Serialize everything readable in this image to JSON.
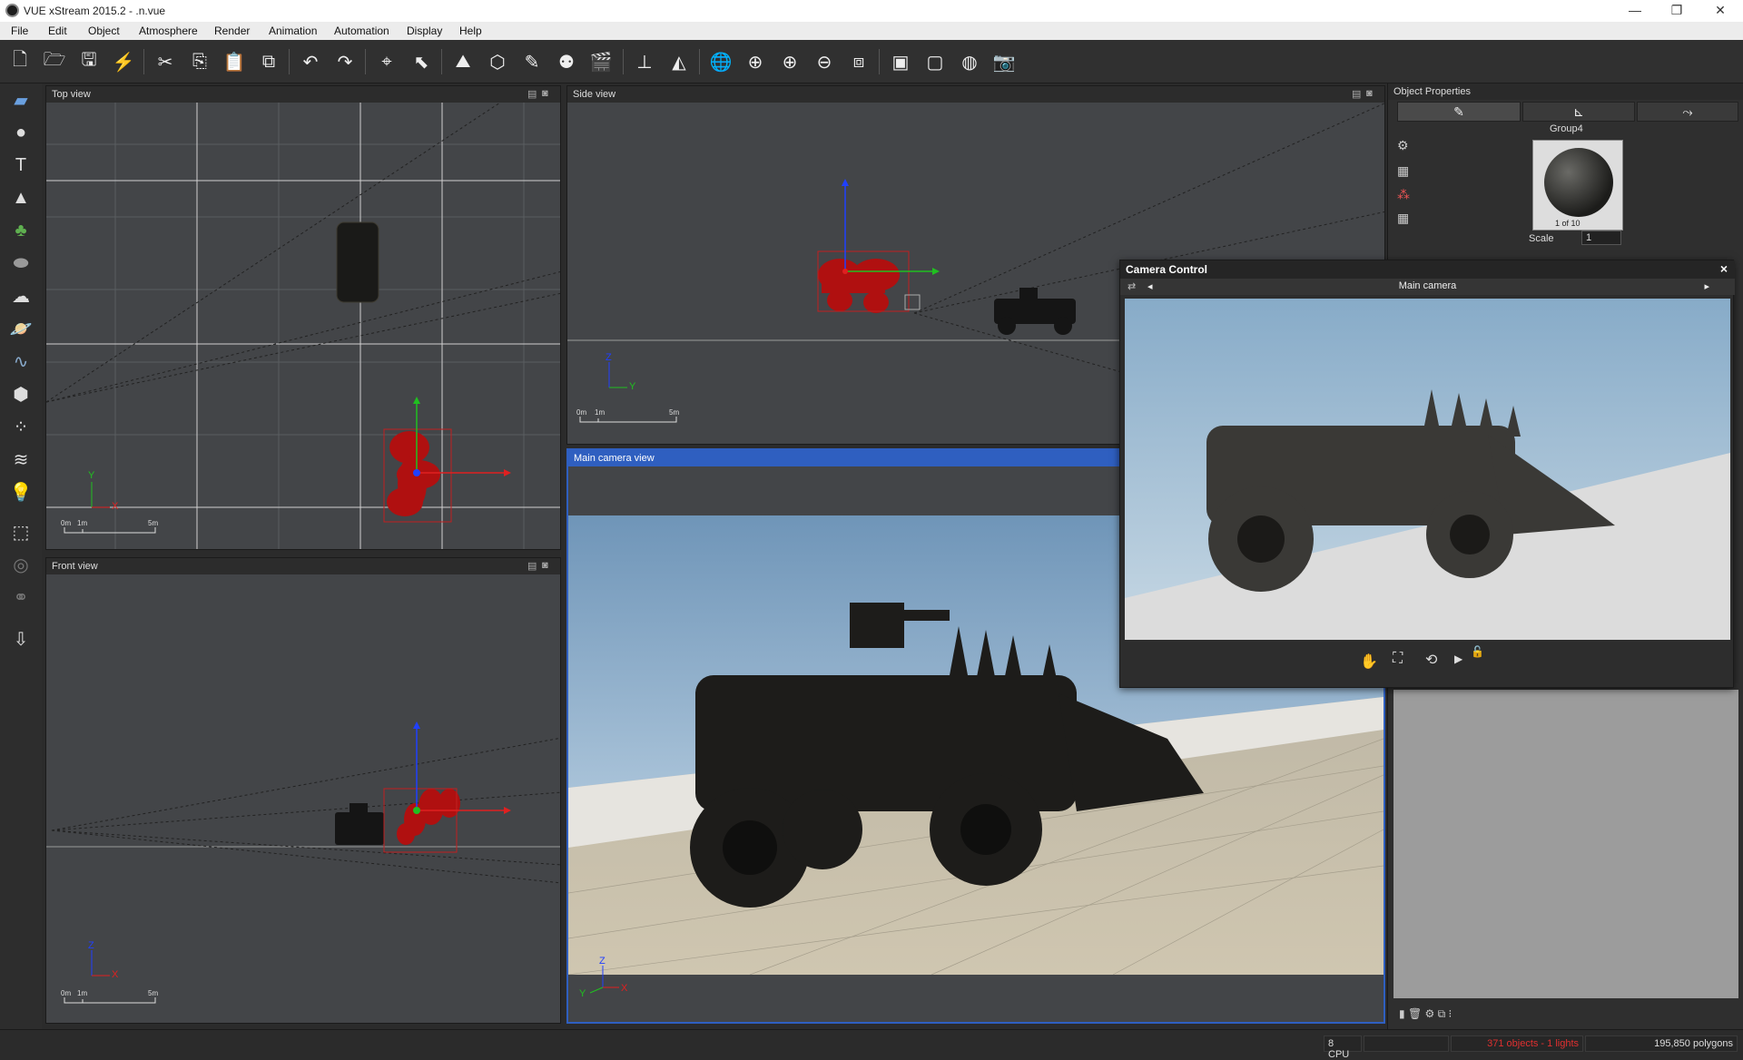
{
  "window": {
    "title": "VUE xStream 2015.2 - .n.vue",
    "minimize": "—",
    "maximize": "❐",
    "close": "✕"
  },
  "menu": [
    "File",
    "Edit",
    "Object",
    "Atmosphere",
    "Render",
    "Animation",
    "Automation",
    "Display",
    "Help"
  ],
  "viewports": {
    "top": {
      "title": "Top view",
      "scale_0": "0m",
      "scale_1": "1m",
      "scale_5": "5m",
      "axis_y": "Y",
      "axis_x": "X"
    },
    "side": {
      "title": "Side view",
      "scale_0": "0m",
      "scale_1": "1m",
      "scale_5": "5m",
      "axis_z": "Z",
      "axis_y": "Y"
    },
    "front": {
      "title": "Front view",
      "scale_0": "0m",
      "scale_1": "1m",
      "scale_5": "5m",
      "axis_z": "Z",
      "axis_x": "X"
    },
    "main": {
      "title": "Main camera view",
      "axis_z": "Z",
      "axis_y": "Y",
      "axis_x": "X"
    }
  },
  "properties": {
    "title": "Object Properties",
    "object_name": "Group4",
    "material_counter": "1 of 10",
    "scale_label": "Scale",
    "scale_value": "1"
  },
  "camera_control": {
    "title": "Camera Control",
    "camera_name": "Main camera",
    "close": "×"
  },
  "status": {
    "cpu": "8 CPU",
    "objects": "371 objects - 1 lights",
    "polygons": "195,850 polygons"
  },
  "colors": {
    "selection": "#b01010",
    "accent": "#2f5fc0",
    "sky": "#8fb3d4"
  }
}
